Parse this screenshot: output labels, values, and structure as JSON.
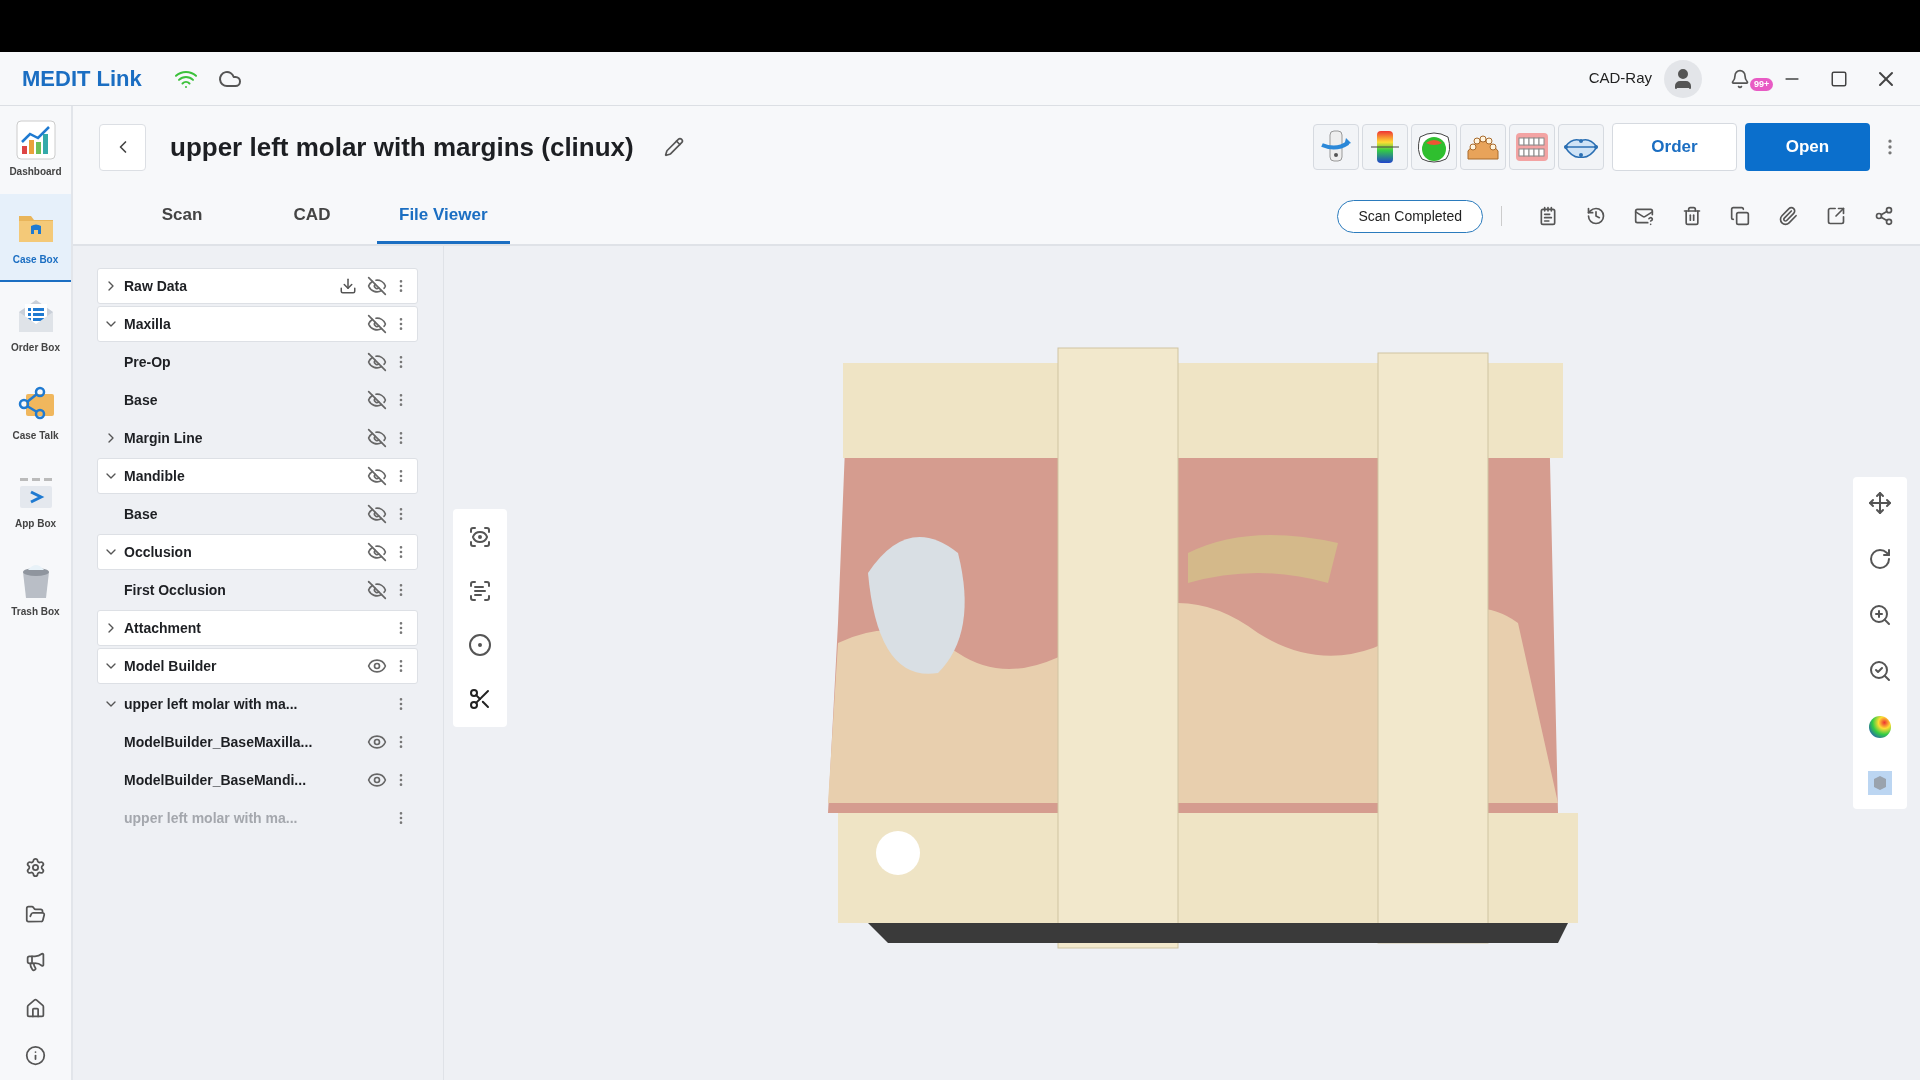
{
  "app": {
    "logo": "MEDIT Link",
    "user": "CAD-Ray",
    "notification_badge": "99+"
  },
  "sidebar": {
    "items": [
      {
        "label": "Dashboard",
        "selected": false
      },
      {
        "label": "Case Box",
        "selected": true
      },
      {
        "label": "Order Box",
        "selected": false
      },
      {
        "label": "Case Talk",
        "selected": false
      },
      {
        "label": "App Box",
        "selected": false
      },
      {
        "label": "Trash Box",
        "selected": false
      }
    ]
  },
  "case": {
    "title": "upper left molar with margins (clinux)",
    "buttons": [
      {
        "label": "Order",
        "kind": "outline"
      },
      {
        "label": "Open",
        "kind": "primary"
      }
    ],
    "status": "Scan Completed"
  },
  "tabs": [
    {
      "label": "Scan",
      "selected": false
    },
    {
      "label": "CAD",
      "selected": false
    },
    {
      "label": "File Viewer",
      "selected": true
    }
  ],
  "tree": [
    {
      "label": "Raw Data",
      "expanded": false,
      "download": true,
      "visible": false,
      "disabled": false
    },
    {
      "label": "Maxilla",
      "expanded": true,
      "visible": false,
      "disabled": false,
      "children": [
        {
          "label": "Pre-Op",
          "visible": false,
          "disabled": false
        },
        {
          "label": "Base",
          "visible": false,
          "disabled": false
        },
        {
          "label": "Margin Line",
          "expanded": false,
          "visible": false,
          "disabled": false
        }
      ]
    },
    {
      "label": "Mandible",
      "expanded": true,
      "visible": false,
      "disabled": false,
      "children": [
        {
          "label": "Base",
          "visible": false,
          "disabled": false
        }
      ]
    },
    {
      "label": "Occlusion",
      "expanded": true,
      "visible": false,
      "disabled": false,
      "children": [
        {
          "label": "First Occlusion",
          "visible": false,
          "disabled": false
        }
      ]
    },
    {
      "label": "Attachment",
      "expanded": false,
      "disabled": false
    },
    {
      "label": "Model Builder",
      "expanded": true,
      "visible": true,
      "disabled": false,
      "children": [
        {
          "label": "upper left molar with ma...",
          "expanded": true,
          "disabled": false,
          "children": [
            {
              "label": "ModelBuilder_BaseMaxilla...",
              "visible": true,
              "disabled": false
            },
            {
              "label": "ModelBuilder_BaseMandi...",
              "visible": true,
              "disabled": false
            },
            {
              "label": "upper left molar with ma...",
              "disabled": true
            }
          ]
        }
      ]
    }
  ]
}
